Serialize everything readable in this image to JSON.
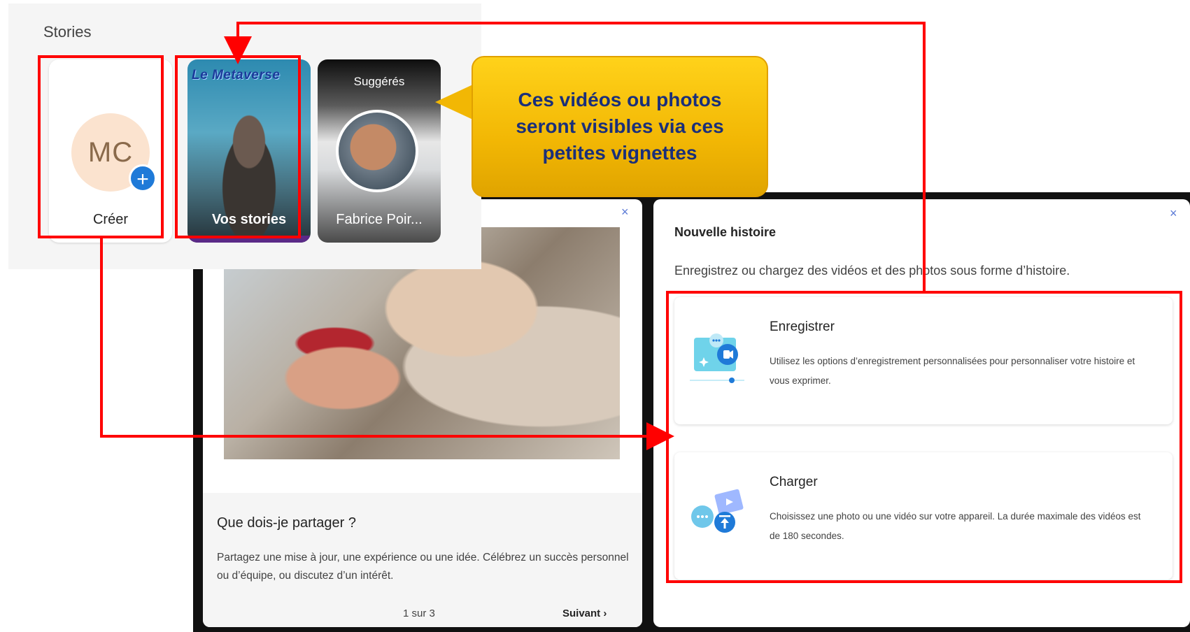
{
  "stories": {
    "title": "Stories",
    "create": {
      "initials": "MC",
      "plus": "+",
      "label": "Créer"
    },
    "my_story": {
      "banner": "Le Metaverse",
      "label": "Vos stories"
    },
    "suggested": {
      "header": "Suggérés",
      "name": "Fabrice Poir..."
    }
  },
  "callout": {
    "text": "Ces vidéos ou photos seront visibles via ces petites vignettes"
  },
  "tip_card": {
    "close_icon": "×",
    "title": "Que dois-je partager ?",
    "text": "Partagez une mise à jour, une expérience ou une idée. Célébrez un succès personnel ou d’équipe, ou discutez d’un intérêt.",
    "pager": "1 sur 3",
    "next_label": "Suivant ›"
  },
  "story_dialog": {
    "close_icon": "×",
    "title": "Nouvelle histoire",
    "subtitle": "Enregistrez ou chargez des vidéos et des photos sous forme d’histoire.",
    "options": [
      {
        "icon": "record-video-icon",
        "title": "Enregistrer",
        "description": "Utilisez les options d’enregistrement personnalisées pour personnaliser votre histoire et vous exprimer."
      },
      {
        "icon": "upload-media-icon",
        "title": "Charger",
        "description": "Choisissez une photo ou une vidéo sur votre appareil. La durée maximale des vidéos est de 180 secondes."
      }
    ]
  },
  "colors": {
    "annotation_red": "#ff0000",
    "callout_yellow": "#f2b704",
    "callout_text": "#1a2f7a",
    "accent_blue": "#1f7ad8"
  }
}
